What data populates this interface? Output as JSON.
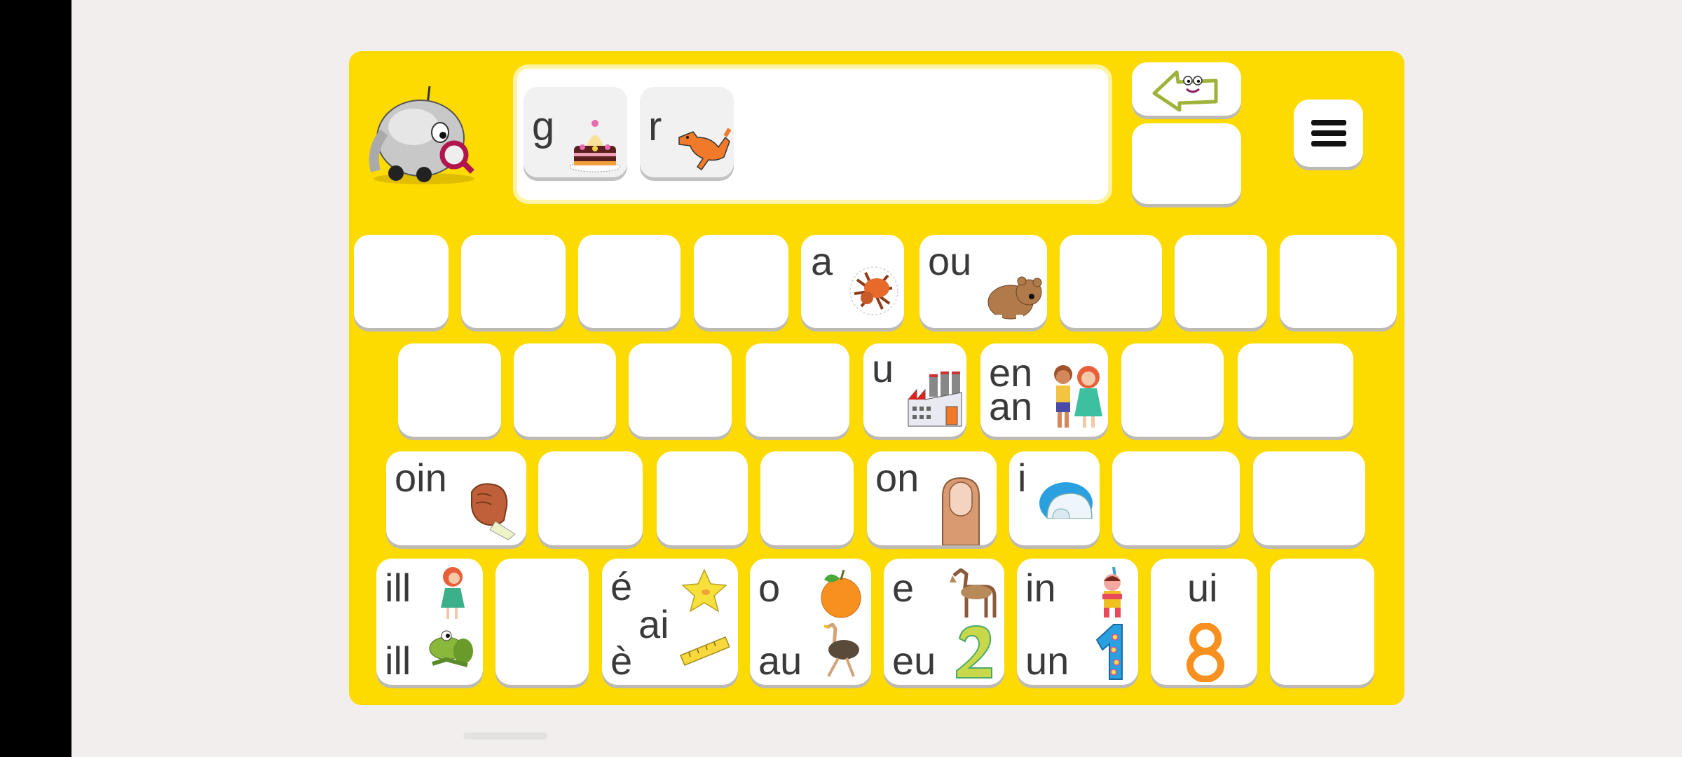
{
  "app": {
    "colors": {
      "panel": "#fedb00",
      "background": "#f2eeee",
      "key": "#ffffff",
      "text": "#3a3a3a",
      "key_shadow": "#bdbab3"
    }
  },
  "header": {
    "mascot_icon": "robot-with-magnifier",
    "word_tiles": [
      {
        "label": "g",
        "picture": "cake-icon"
      },
      {
        "label": "r",
        "picture": "fox-icon"
      }
    ],
    "back_button_icon": "smiling-left-arrow-icon",
    "menu_button_icon": "hamburger-menu-icon"
  },
  "keyboard": {
    "row1": [
      {
        "label": ""
      },
      {
        "label": ""
      },
      {
        "label": ""
      },
      {
        "label": ""
      },
      {
        "label": "a",
        "picture": "spider-icon"
      },
      {
        "label": "ou",
        "picture": "bear-icon"
      },
      {
        "label": ""
      },
      {
        "label": ""
      },
      {
        "label": ""
      }
    ],
    "row2": [
      {
        "label": ""
      },
      {
        "label": ""
      },
      {
        "label": ""
      },
      {
        "label": ""
      },
      {
        "label": "u",
        "picture": "factory-icon"
      },
      {
        "label_top": "en",
        "label_bottom": "an",
        "picture": "children-icon"
      },
      {
        "label": ""
      },
      {
        "label": ""
      }
    ],
    "row3": [
      {
        "label": "oin",
        "picture": "fist-icon"
      },
      {
        "label": ""
      },
      {
        "label": ""
      },
      {
        "label": ""
      },
      {
        "label": "on",
        "picture": "thumb-nail-icon"
      },
      {
        "label": "i",
        "picture": "igloo-icon"
      },
      {
        "label": ""
      },
      {
        "label": ""
      }
    ],
    "row4": [
      {
        "label_top": "ill",
        "label_bottom": "ill",
        "picture_top": "girl-icon",
        "picture_bottom": "frog-icon"
      },
      {
        "label": ""
      },
      {
        "label_top": "é",
        "label_mid": "ai",
        "label_bottom": "è",
        "picture_top": "star-icon",
        "picture_bottom": "ruler-icon"
      },
      {
        "label_top": "o",
        "label_bottom": "au",
        "picture_top": "orange-icon",
        "picture_bottom": "ostrich-icon"
      },
      {
        "label_top": "e",
        "label_bottom": "eu",
        "picture_top": "horse-icon",
        "picture_bottom": "number-two-icon"
      },
      {
        "label_top": "in",
        "label_bottom": "un",
        "picture_top": "native-child-icon",
        "picture_bottom": "number-one-icon"
      },
      {
        "label_top": "ui",
        "picture_bottom": "number-eight-icon"
      },
      {
        "label": ""
      }
    ]
  }
}
